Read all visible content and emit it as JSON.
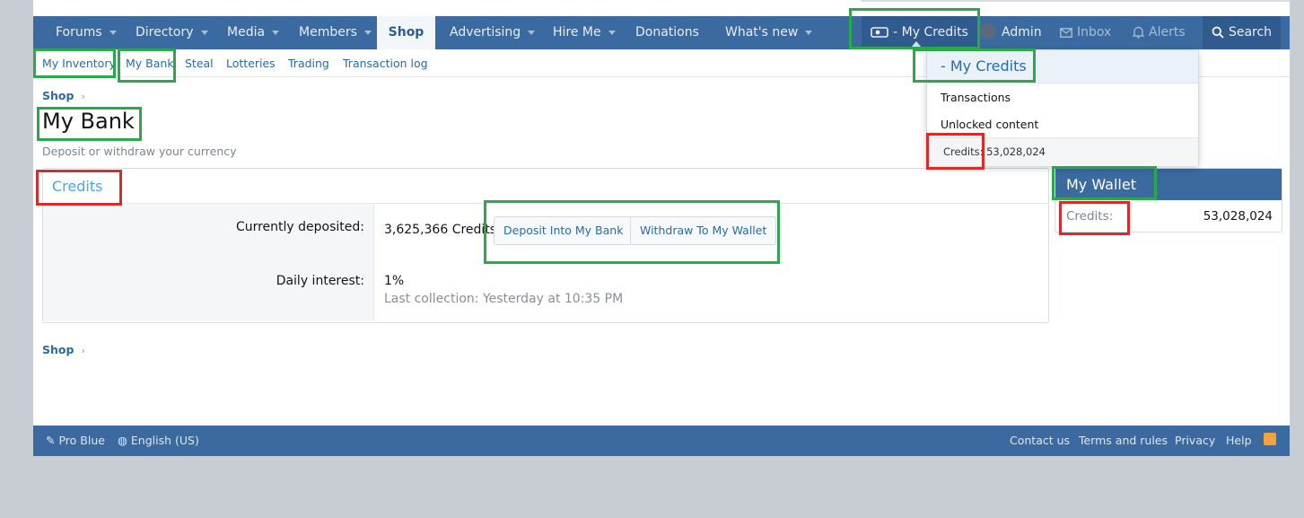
{
  "nav": {
    "items": [
      {
        "label": "Forums",
        "dropdown": true
      },
      {
        "label": "Directory",
        "dropdown": true
      },
      {
        "label": "Media",
        "dropdown": true
      },
      {
        "label": "Members",
        "dropdown": true
      },
      {
        "label": "Shop",
        "dropdown": false,
        "active": true
      },
      {
        "label": "Advertising",
        "dropdown": true
      },
      {
        "label": "Hire Me",
        "dropdown": true
      },
      {
        "label": "Donations",
        "dropdown": false
      },
      {
        "label": "What's new",
        "dropdown": true
      }
    ],
    "my_credits": "- My Credits",
    "admin": "Admin",
    "inbox": "Inbox",
    "alerts": "Alerts",
    "search": "Search"
  },
  "subnav": [
    "My Inventory",
    "My Bank",
    "Steal",
    "Lotteries",
    "Trading",
    "Transaction log"
  ],
  "breadcrumb": "Shop",
  "page": {
    "title": "My Bank",
    "description": "Deposit or withdraw your currency"
  },
  "block": {
    "tab": "Credits",
    "deposited_label": "Currently deposited:",
    "deposited_value": "3,625,366 Credits",
    "deposit_button": "Deposit Into My Bank",
    "withdraw_button": "Withdraw To My Wallet",
    "interest_label": "Daily interest:",
    "interest_value": "1%",
    "last_collection": "Last collection: Yesterday at 10:35 PM"
  },
  "wallet": {
    "title": "My Wallet",
    "label": "Credits:",
    "value": "53,028,024"
  },
  "dropdown": {
    "title": "- My Credits",
    "links": [
      "Transactions",
      "Unlocked content"
    ],
    "footer": "Credits: 53,028,024"
  },
  "footer": {
    "style": "Pro Blue",
    "language": "English (US)",
    "links": [
      "Contact us",
      "Terms and rules",
      "Privacy",
      "Help"
    ]
  },
  "colors": {
    "nav": "#3a6aa0",
    "link": "#2a6aa5",
    "highlight_green": "#2aa84a",
    "highlight_red": "#d92b2b"
  }
}
